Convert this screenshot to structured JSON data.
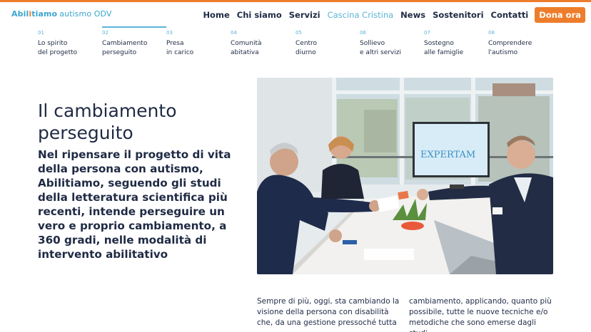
{
  "brand": {
    "logo_main_pre": "Abil",
    "logo_main_i": "i",
    "logo_main_post": "tiamo",
    "logo_sub": "autismo ODV"
  },
  "nav": {
    "items": [
      {
        "label": "Home"
      },
      {
        "label": "Chi siamo"
      },
      {
        "label": "Servizi"
      },
      {
        "label": "Cascina Cristina"
      },
      {
        "label": "News"
      },
      {
        "label": "Sostenitori"
      },
      {
        "label": "Contatti"
      }
    ],
    "active": "Cascina Cristina",
    "donate_label": "Dona ora"
  },
  "steps": [
    {
      "num": "01",
      "label": "Lo spirito\ndel progetto"
    },
    {
      "num": "02",
      "label": "Cambiamento\nperseguito"
    },
    {
      "num": "03",
      "label": "Presa\nin carico"
    },
    {
      "num": "04",
      "label": "Comunità\nabitativa"
    },
    {
      "num": "05",
      "label": "Centro\ndiurno"
    },
    {
      "num": "06",
      "label": "Sollievo\ne altri servizi"
    },
    {
      "num": "07",
      "label": "Sostegno\nalle famiglie"
    },
    {
      "num": "08",
      "label": "Comprendere\nl'autismo"
    }
  ],
  "active_step": "02",
  "main": {
    "title": "Il cambiamento\nperseguito",
    "lead": "Nel ripensare il progetto di vita della persona con autismo, Abilitiamo, seguendo gli studi della letteratura scientifica più recenti, intende perseguire un vero e proprio cambiamento, a 360 gradi, nelle modalità di intervento abilitativo",
    "photo_screen_text": "EXPERTAM",
    "body_col1": "Sempre di più, oggi, sta cambiando la visione della persona con disabilità che, da una gestione pressoché tutta",
    "body_col2": "cambiamento, applicando, quanto più possibile, tutte le nuove tecniche e/o metodiche che sono emerse dagli studi"
  },
  "colors": {
    "accent_orange": "#ee7d2b",
    "accent_blue": "#5bb4d6",
    "text_navy": "#1f2a44"
  }
}
